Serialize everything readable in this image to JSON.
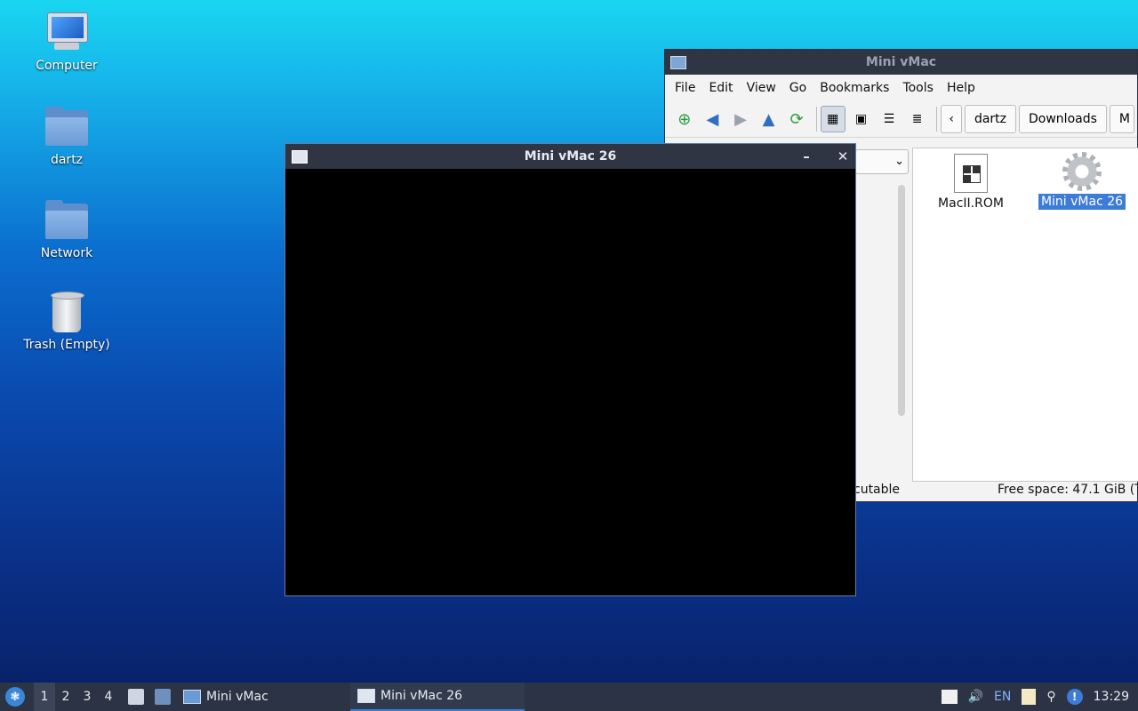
{
  "desktop": {
    "icons": [
      {
        "label": "Computer"
      },
      {
        "label": "dartz"
      },
      {
        "label": "Network"
      },
      {
        "label": "Trash (Empty)"
      }
    ]
  },
  "file_manager": {
    "title": "Mini vMac",
    "menu": [
      "File",
      "Edit",
      "View",
      "Go",
      "Bookmarks",
      "Tools",
      "Help"
    ],
    "breadcrumb": [
      "dartz",
      "Downloads",
      "M"
    ],
    "dropdown_value": "",
    "files": [
      {
        "name": "MacII.ROM",
        "icon": "rom-file-icon"
      },
      {
        "name": "Mini vMac 26",
        "icon": "gear-executable-icon",
        "selected": true
      }
    ],
    "status_left": "cutable",
    "status_right": "Free space: 47.1 GiB (To"
  },
  "vmac_window": {
    "title": "Mini vMac 26",
    "minimize": "–",
    "close": "✕"
  },
  "taskbar": {
    "workspaces": [
      "1",
      "2",
      "3",
      "4"
    ],
    "tasks": [
      {
        "label": "Mini vMac",
        "active": false
      },
      {
        "label": "Mini vMac 26",
        "active": true
      }
    ],
    "tray": {
      "lang": "EN",
      "clock": "13:29"
    }
  }
}
